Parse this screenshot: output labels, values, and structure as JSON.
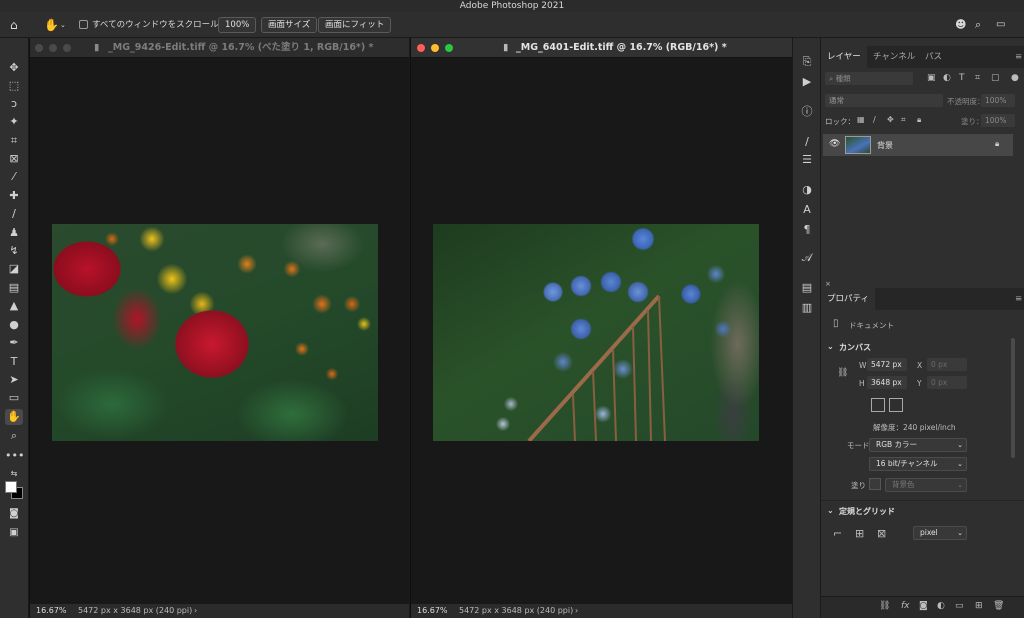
{
  "app": {
    "title": "Adobe Photoshop 2021"
  },
  "options_bar": {
    "scroll_all_label": "すべてのウィンドウをスクロール",
    "zoom_100": "100%",
    "fit_screen": "画面サイズ",
    "fill_screen": "画面にフィット"
  },
  "documents": [
    {
      "title": "_MG_9426-Edit.tiff @ 16.7% (べた塗り 1, RGB/16*) *",
      "zoom": "16.67%",
      "info": "5472 px x 3648 px (240 ppi)",
      "image": "red and yellow flowers photo"
    },
    {
      "title": "_MG_6401-Edit.tiff @ 16.7% (RGB/16*) *",
      "zoom": "16.67%",
      "info": "5472 px x 3648 px (240 ppi)",
      "image": "blue hydrangea and stair railing photo"
    }
  ],
  "layers_panel": {
    "tabs": [
      "レイヤー",
      "チャンネル",
      "パス"
    ],
    "filter_placeholder": "種類",
    "blend_mode": "通常",
    "opacity_label": "不透明度：",
    "opacity_value": "100%",
    "lock_label": "ロック：",
    "fill_label": "塗り：",
    "fill_value": "100%",
    "layers": [
      {
        "name": "背景",
        "locked": true,
        "visible": true
      }
    ]
  },
  "properties_panel": {
    "title": "プロパティ",
    "doc_label": "ドキュメント",
    "canvas_section": "カンバス",
    "w_label": "W",
    "w_value": "5472 px",
    "x_label": "X",
    "x_placeholder": "0 px",
    "h_label": "H",
    "h_value": "3648 px",
    "y_label": "Y",
    "y_placeholder": "0 px",
    "resolution": "解像度：240 pixel/inch",
    "mode_label": "モード",
    "mode_value": "RGB カラー",
    "depth_value": "16 bit/チャンネル",
    "fill_label": "塗り",
    "fill_value": "背景色",
    "rulers_section": "定規とグリッド",
    "unit_value": "pixel"
  },
  "colors": {
    "red_light": "#ff5f57",
    "yellow_light": "#febc2e",
    "green_light": "#28c840"
  }
}
